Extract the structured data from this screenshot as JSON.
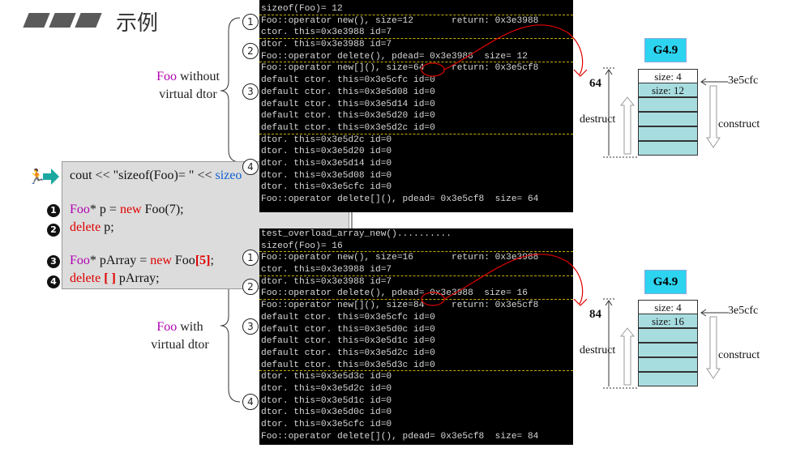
{
  "title": "示例",
  "labels": {
    "top_kw": "Foo",
    "top_rest": " without",
    "top_line2": "virtual dtor",
    "bottom_kw": "Foo",
    "bottom_rest": " with",
    "bottom_line2": "virtual dtor"
  },
  "code": {
    "line0": {
      "a": "cout << \"sizeof(Foo)= \" << ",
      "b": "sizeo"
    },
    "line1": {
      "a": "Foo",
      "b": "* p = ",
      "c": "new",
      "d": " Foo(7);"
    },
    "line2": {
      "a": "delete",
      "b": " p;"
    },
    "line3": {
      "a": "Foo",
      "b": "* pArray = ",
      "c": "new",
      "d": " Foo",
      "e": "[5]",
      "f": ";"
    },
    "line4": {
      "a": "delete",
      "b": " [ ]",
      "c": " pArray;"
    },
    "num1": "1",
    "num2": "2",
    "num3": "3",
    "num4": "4"
  },
  "console_top": [
    "sizeof(Foo)= 12",
    "Foo::operator new(), size=12       return: 0x3e3988",
    "ctor. this=0x3e3988 id=7",
    "dtor. this=0x3e3988 id=7",
    "Foo::operator delete(), pdead= 0x3e3988  size= 12",
    "Foo::operator new[](), size=64     return: 0x3e5cf8",
    "default ctor. this=0x3e5cfc id=0",
    "default ctor. this=0x3e5d08 id=0",
    "default ctor. this=0x3e5d14 id=0",
    "default ctor. this=0x3e5d20 id=0",
    "default ctor. this=0x3e5d2c id=0",
    "dtor. this=0x3e5d2c id=0",
    "dtor. this=0x3e5d20 id=0",
    "dtor. this=0x3e5d14 id=0",
    "dtor. this=0x3e5d08 id=0",
    "dtor. this=0x3e5cfc id=0",
    "Foo::operator delete[](), pdead= 0x3e5cf8  size= 64"
  ],
  "console_bottom": [
    "test_overload_array_new()..........",
    "sizeof(Foo)= 16",
    "Foo::operator new(), size=16       return: 0x3e3988",
    "ctor. this=0x3e3988 id=7",
    "dtor. this=0x3e3988 id=7",
    "Foo::operator delete(), pdead= 0x3e3988  size= 16",
    "Foo::operator new[](), size=84     return: 0x3e5cf8",
    "default ctor. this=0x3e5cfc id=0",
    "default ctor. this=0x3e5d0c id=0",
    "default ctor. this=0x3e5d1c id=0",
    "default ctor. this=0x3e5d2c id=0",
    "default ctor. this=0x3e5d3c id=0",
    "dtor. this=0x3e5d3c id=0",
    "dtor. this=0x3e5d2c id=0",
    "dtor. this=0x3e5d1c id=0",
    "dtor. this=0x3e5d0c id=0",
    "dtor. this=0x3e5cfc id=0",
    "Foo::operator delete[](), pdead= 0x3e5cf8  size= 84"
  ],
  "markers": {
    "m1": "1",
    "m2": "2",
    "m3": "3",
    "m4": "4"
  },
  "diagram_top": {
    "label": "G4.9",
    "cell0": "size: 4",
    "cell1": "size: 12",
    "total": "64",
    "addr": "3e5cfc",
    "destruct": "destruct",
    "construct": "construct"
  },
  "diagram_bottom": {
    "label": "G4.9",
    "cell0": "size: 4",
    "cell1": "size: 16",
    "total": "84",
    "addr": "3e5cfc",
    "destruct": "destruct",
    "construct": "construct"
  },
  "colors": {
    "accent_teal": "#1aa8a0",
    "keyword_purple": "#b000b0",
    "new_red": "#e00000",
    "g_label": "#2dd4f0",
    "cell": "#a8dde0"
  }
}
